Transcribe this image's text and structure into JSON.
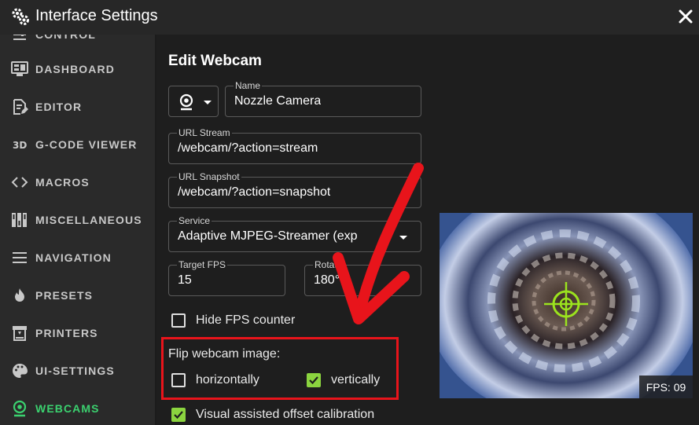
{
  "window": {
    "title": "Interface Settings"
  },
  "sidebar": {
    "items": [
      {
        "label": "CONTROL",
        "icon": "tune-icon",
        "active": false
      },
      {
        "label": "DASHBOARD",
        "icon": "monitor-dashboard-icon",
        "active": false
      },
      {
        "label": "EDITOR",
        "icon": "file-document-edit-icon",
        "active": false
      },
      {
        "label": "G-CODE VIEWER",
        "icon": "3d-icon",
        "active": false
      },
      {
        "label": "MACROS",
        "icon": "code-brackets-icon",
        "active": false
      },
      {
        "label": "MISCELLANEOUS",
        "icon": "dip-switch-icon",
        "active": false
      },
      {
        "label": "NAVIGATION",
        "icon": "menu-icon",
        "active": false
      },
      {
        "label": "PRESETS",
        "icon": "fire-icon",
        "active": false
      },
      {
        "label": "PRINTERS",
        "icon": "printer-3d-icon",
        "active": false
      },
      {
        "label": "UI-SETTINGS",
        "icon": "palette-icon",
        "active": false
      },
      {
        "label": "WEBCAMS",
        "icon": "webcam-icon",
        "active": true
      }
    ]
  },
  "form": {
    "heading": "Edit Webcam",
    "name": {
      "label": "Name",
      "value": "Nozzle Camera"
    },
    "url_stream": {
      "label": "URL Stream",
      "value": "/webcam/?action=stream"
    },
    "url_snapshot": {
      "label": "URL Snapshot",
      "value": "/webcam/?action=snapshot"
    },
    "service": {
      "label": "Service",
      "value": "Adaptive MJPEG-Streamer (exp"
    },
    "target_fps": {
      "label": "Target FPS",
      "value": "15"
    },
    "rotate": {
      "label": "Rotate",
      "value": "180°"
    },
    "hide_fps": {
      "label": "Hide FPS counter",
      "checked": false
    },
    "flip_title": "Flip webcam image:",
    "flip_horizontal": {
      "label": "horizontally",
      "checked": false
    },
    "flip_vertical": {
      "label": "vertically",
      "checked": true
    },
    "visual_offset": {
      "label": "Visual assisted offset calibration",
      "checked": true
    }
  },
  "preview": {
    "fps_text": "FPS: 09"
  },
  "colors": {
    "accent": "#3bd16f",
    "checkbox_checked": "#8bd43f",
    "annotation_red": "#e8141b",
    "crosshair": "#9be31e"
  }
}
